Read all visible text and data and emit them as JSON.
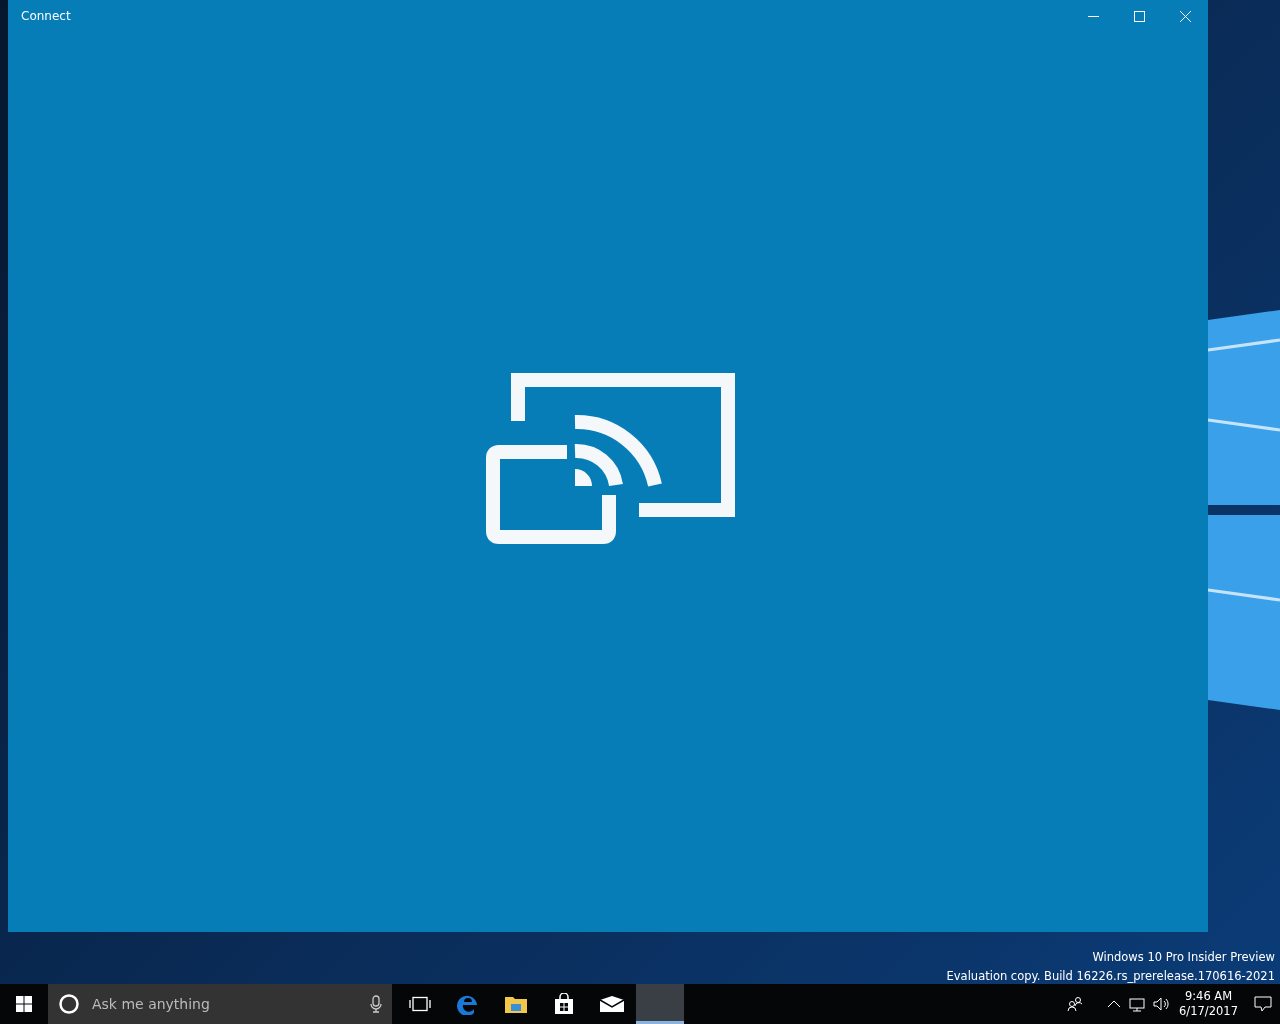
{
  "window": {
    "title": "Connect"
  },
  "desktop": {
    "build_info": [
      "Windows 10 Pro Insider Preview",
      "Evaluation copy. Build 16226.rs_prerelease.170616-2021"
    ]
  },
  "taskbar": {
    "search": {
      "placeholder": "Ask me anything"
    },
    "apps": [
      {
        "kind": "taskview",
        "selected": false
      },
      {
        "kind": "edge",
        "selected": false
      },
      {
        "kind": "explorer",
        "selected": false
      },
      {
        "kind": "store",
        "selected": false
      },
      {
        "kind": "mail",
        "selected": false
      },
      {
        "kind": "blank",
        "selected": true
      }
    ],
    "clock": {
      "time": "9:46 AM",
      "date": "6/17/2017"
    }
  }
}
